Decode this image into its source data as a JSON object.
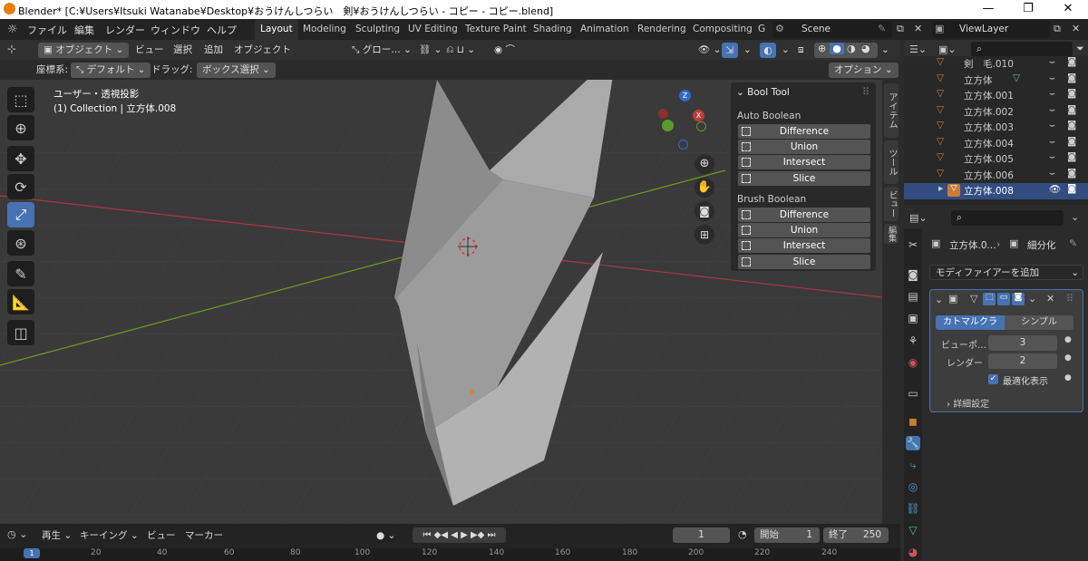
{
  "titlebar": {
    "text": "Blender* [C:¥Users¥Itsuki Watanabe¥Desktop¥おうけんしつらい　剣¥おうけんしつらい - コピー - コピー.blend]",
    "min": "—",
    "max": "❐",
    "close": "✕"
  },
  "menubar": {
    "items": [
      "ファイル",
      "編集",
      "レンダー",
      "ウィンドウ",
      "ヘルプ"
    ]
  },
  "workspaces": [
    "Layout",
    "Modeling",
    "Sculpting",
    "UV Editing",
    "Texture Paint",
    "Shading",
    "Animation",
    "Rendering",
    "Compositing",
    "G"
  ],
  "scene": {
    "value": "Scene"
  },
  "viewlayer": {
    "value": "ViewLayer"
  },
  "viewport_header": {
    "mode": "オブジェクト",
    "view": "ビュー",
    "select": "選択",
    "add": "追加",
    "object": "オブジェクト",
    "transform": "グロー…"
  },
  "viewport_header2": {
    "coord_label": "座標系:",
    "coord_value": "デフォルト",
    "drag_label": "ドラッグ:",
    "drag_value": "ボックス選択",
    "options": "オプション"
  },
  "viewport": {
    "view_name": "ユーザー・透視投影",
    "collection_info": "(1) Collection | 立方体.008"
  },
  "gizmo": {
    "x": "X",
    "y": "Y",
    "z": "Z"
  },
  "boolpanel": {
    "title": "Bool Tool",
    "auto_label": "Auto Boolean",
    "brush_label": "Brush Boolean",
    "auto": [
      "Difference",
      "Union",
      "Intersect",
      "Slice"
    ],
    "brush": [
      "Difference",
      "Union",
      "Intersect",
      "Slice"
    ]
  },
  "ntabs": [
    "アイテム",
    "ツール",
    "ビュー",
    "編集"
  ],
  "timeline": {
    "playback": "再生",
    "keying": "キーイング",
    "view": "ビュー",
    "marker": "マーカー",
    "current_frame": "1",
    "start_label": "開始",
    "start": "1",
    "end_label": "終了",
    "end": "250",
    "ruler": [
      "1",
      "20",
      "40",
      "60",
      "80",
      "100",
      "120",
      "140",
      "160",
      "180",
      "200",
      "220",
      "240"
    ]
  },
  "outliner": {
    "rows": [
      "剣　毛.010",
      "立方体",
      "立方体.001",
      "立方体.002",
      "立方体.003",
      "立方体.004",
      "立方体.005",
      "立方体.006",
      "立方体.008"
    ]
  },
  "properties": {
    "breadcrumb_obj": "立方体.0...",
    "breadcrumb_mod": "細分化",
    "add_modifier": "モディファイアーを追加",
    "tab_catmull": "カトマルクラー…",
    "tab_simple": "シンプル",
    "viewport_label": "ビューポ…",
    "viewport_value": "3",
    "render_label": "レンダー",
    "render_value": "2",
    "optimal_label": "最適化表示",
    "advanced": "詳細設定"
  },
  "colors": {
    "accent": "#4772b3",
    "x_axis": "#b0343f",
    "y_axis": "#6b9c1f",
    "object_orange": "#e0822b"
  }
}
